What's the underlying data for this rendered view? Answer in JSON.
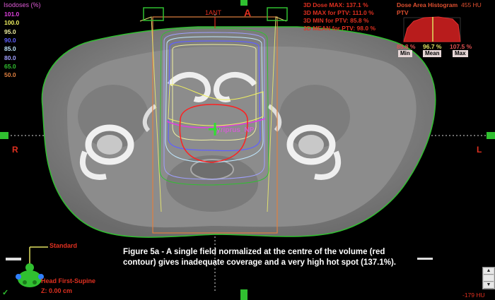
{
  "isodose_legend": {
    "title": "Isodoses (%)",
    "levels": [
      {
        "label": "101.0",
        "color": "#e040e0"
      },
      {
        "label": "100.0",
        "color": "#f0f060"
      },
      {
        "label": "95.0",
        "color": "#f0f0a0"
      },
      {
        "label": "90.0",
        "color": "#6060ff"
      },
      {
        "label": "85.0",
        "color": "#c0e8ff"
      },
      {
        "label": "80.0",
        "color": "#a0a0ff"
      },
      {
        "label": "65.0",
        "color": "#30c030"
      },
      {
        "label": "50.0",
        "color": "#e08040"
      }
    ]
  },
  "dose_stats": [
    "3D Dose MAX: 137.1 %",
    "3D MAX for PTV: 111.0 %",
    "3D MIN for PTV: 85.8 %",
    "3D MEAN for PTV: 98.0 %"
  ],
  "histogram": {
    "title": "Dose Area Histogram",
    "structure": "PTV",
    "min_value": "85.8 %",
    "mean_value": "96.7 %",
    "max_value": "107.5 %",
    "min_label": "Min",
    "mean_label": "Mean",
    "max_label": "Max"
  },
  "hu": {
    "top": "455 HU",
    "bottom": "-179 HU"
  },
  "beam": {
    "name": "1ANT",
    "anterior_marker": "A",
    "right_marker": "R",
    "left_marker": "L"
  },
  "structure_label": "yriprus_NP",
  "orientation": {
    "name": "Standard",
    "position": "Head First-Supine",
    "z": "Z: 0.00 cm"
  },
  "caption": "Figure 5a - A single field normalized at the centre of the volume (red contour) gives inadequate coverage and a very high hot spot (137.1%).",
  "colors": {
    "accent_red": "#e03020",
    "isodose_magenta": "#e040e0",
    "ct_gray": "#8a8a8a"
  }
}
